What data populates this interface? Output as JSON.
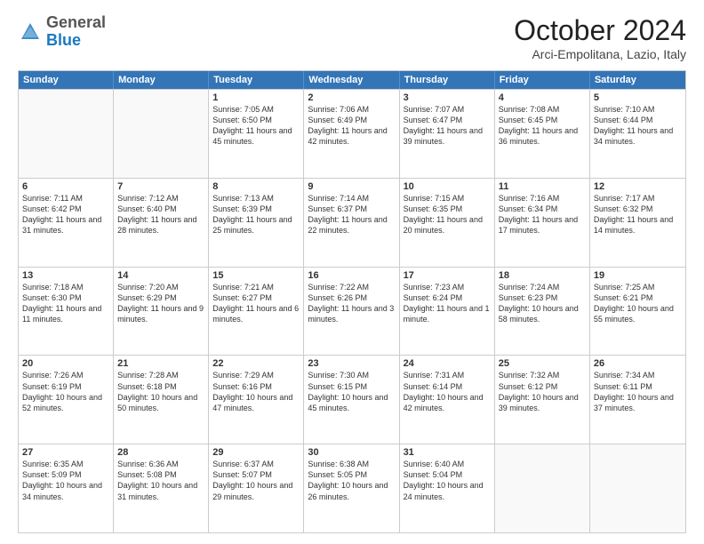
{
  "header": {
    "logo_general": "General",
    "logo_blue": "Blue",
    "month": "October 2024",
    "location": "Arci-Empolitana, Lazio, Italy"
  },
  "days_of_week": [
    "Sunday",
    "Monday",
    "Tuesday",
    "Wednesday",
    "Thursday",
    "Friday",
    "Saturday"
  ],
  "weeks": [
    [
      {
        "day": "",
        "text": "",
        "empty": true
      },
      {
        "day": "",
        "text": "",
        "empty": true
      },
      {
        "day": "1",
        "text": "Sunrise: 7:05 AM\nSunset: 6:50 PM\nDaylight: 11 hours and 45 minutes.",
        "empty": false
      },
      {
        "day": "2",
        "text": "Sunrise: 7:06 AM\nSunset: 6:49 PM\nDaylight: 11 hours and 42 minutes.",
        "empty": false
      },
      {
        "day": "3",
        "text": "Sunrise: 7:07 AM\nSunset: 6:47 PM\nDaylight: 11 hours and 39 minutes.",
        "empty": false
      },
      {
        "day": "4",
        "text": "Sunrise: 7:08 AM\nSunset: 6:45 PM\nDaylight: 11 hours and 36 minutes.",
        "empty": false
      },
      {
        "day": "5",
        "text": "Sunrise: 7:10 AM\nSunset: 6:44 PM\nDaylight: 11 hours and 34 minutes.",
        "empty": false
      }
    ],
    [
      {
        "day": "6",
        "text": "Sunrise: 7:11 AM\nSunset: 6:42 PM\nDaylight: 11 hours and 31 minutes.",
        "empty": false
      },
      {
        "day": "7",
        "text": "Sunrise: 7:12 AM\nSunset: 6:40 PM\nDaylight: 11 hours and 28 minutes.",
        "empty": false
      },
      {
        "day": "8",
        "text": "Sunrise: 7:13 AM\nSunset: 6:39 PM\nDaylight: 11 hours and 25 minutes.",
        "empty": false
      },
      {
        "day": "9",
        "text": "Sunrise: 7:14 AM\nSunset: 6:37 PM\nDaylight: 11 hours and 22 minutes.",
        "empty": false
      },
      {
        "day": "10",
        "text": "Sunrise: 7:15 AM\nSunset: 6:35 PM\nDaylight: 11 hours and 20 minutes.",
        "empty": false
      },
      {
        "day": "11",
        "text": "Sunrise: 7:16 AM\nSunset: 6:34 PM\nDaylight: 11 hours and 17 minutes.",
        "empty": false
      },
      {
        "day": "12",
        "text": "Sunrise: 7:17 AM\nSunset: 6:32 PM\nDaylight: 11 hours and 14 minutes.",
        "empty": false
      }
    ],
    [
      {
        "day": "13",
        "text": "Sunrise: 7:18 AM\nSunset: 6:30 PM\nDaylight: 11 hours and 11 minutes.",
        "empty": false
      },
      {
        "day": "14",
        "text": "Sunrise: 7:20 AM\nSunset: 6:29 PM\nDaylight: 11 hours and 9 minutes.",
        "empty": false
      },
      {
        "day": "15",
        "text": "Sunrise: 7:21 AM\nSunset: 6:27 PM\nDaylight: 11 hours and 6 minutes.",
        "empty": false
      },
      {
        "day": "16",
        "text": "Sunrise: 7:22 AM\nSunset: 6:26 PM\nDaylight: 11 hours and 3 minutes.",
        "empty": false
      },
      {
        "day": "17",
        "text": "Sunrise: 7:23 AM\nSunset: 6:24 PM\nDaylight: 11 hours and 1 minute.",
        "empty": false
      },
      {
        "day": "18",
        "text": "Sunrise: 7:24 AM\nSunset: 6:23 PM\nDaylight: 10 hours and 58 minutes.",
        "empty": false
      },
      {
        "day": "19",
        "text": "Sunrise: 7:25 AM\nSunset: 6:21 PM\nDaylight: 10 hours and 55 minutes.",
        "empty": false
      }
    ],
    [
      {
        "day": "20",
        "text": "Sunrise: 7:26 AM\nSunset: 6:19 PM\nDaylight: 10 hours and 52 minutes.",
        "empty": false
      },
      {
        "day": "21",
        "text": "Sunrise: 7:28 AM\nSunset: 6:18 PM\nDaylight: 10 hours and 50 minutes.",
        "empty": false
      },
      {
        "day": "22",
        "text": "Sunrise: 7:29 AM\nSunset: 6:16 PM\nDaylight: 10 hours and 47 minutes.",
        "empty": false
      },
      {
        "day": "23",
        "text": "Sunrise: 7:30 AM\nSunset: 6:15 PM\nDaylight: 10 hours and 45 minutes.",
        "empty": false
      },
      {
        "day": "24",
        "text": "Sunrise: 7:31 AM\nSunset: 6:14 PM\nDaylight: 10 hours and 42 minutes.",
        "empty": false
      },
      {
        "day": "25",
        "text": "Sunrise: 7:32 AM\nSunset: 6:12 PM\nDaylight: 10 hours and 39 minutes.",
        "empty": false
      },
      {
        "day": "26",
        "text": "Sunrise: 7:34 AM\nSunset: 6:11 PM\nDaylight: 10 hours and 37 minutes.",
        "empty": false
      }
    ],
    [
      {
        "day": "27",
        "text": "Sunrise: 6:35 AM\nSunset: 5:09 PM\nDaylight: 10 hours and 34 minutes.",
        "empty": false
      },
      {
        "day": "28",
        "text": "Sunrise: 6:36 AM\nSunset: 5:08 PM\nDaylight: 10 hours and 31 minutes.",
        "empty": false
      },
      {
        "day": "29",
        "text": "Sunrise: 6:37 AM\nSunset: 5:07 PM\nDaylight: 10 hours and 29 minutes.",
        "empty": false
      },
      {
        "day": "30",
        "text": "Sunrise: 6:38 AM\nSunset: 5:05 PM\nDaylight: 10 hours and 26 minutes.",
        "empty": false
      },
      {
        "day": "31",
        "text": "Sunrise: 6:40 AM\nSunset: 5:04 PM\nDaylight: 10 hours and 24 minutes.",
        "empty": false
      },
      {
        "day": "",
        "text": "",
        "empty": true
      },
      {
        "day": "",
        "text": "",
        "empty": true
      }
    ]
  ]
}
